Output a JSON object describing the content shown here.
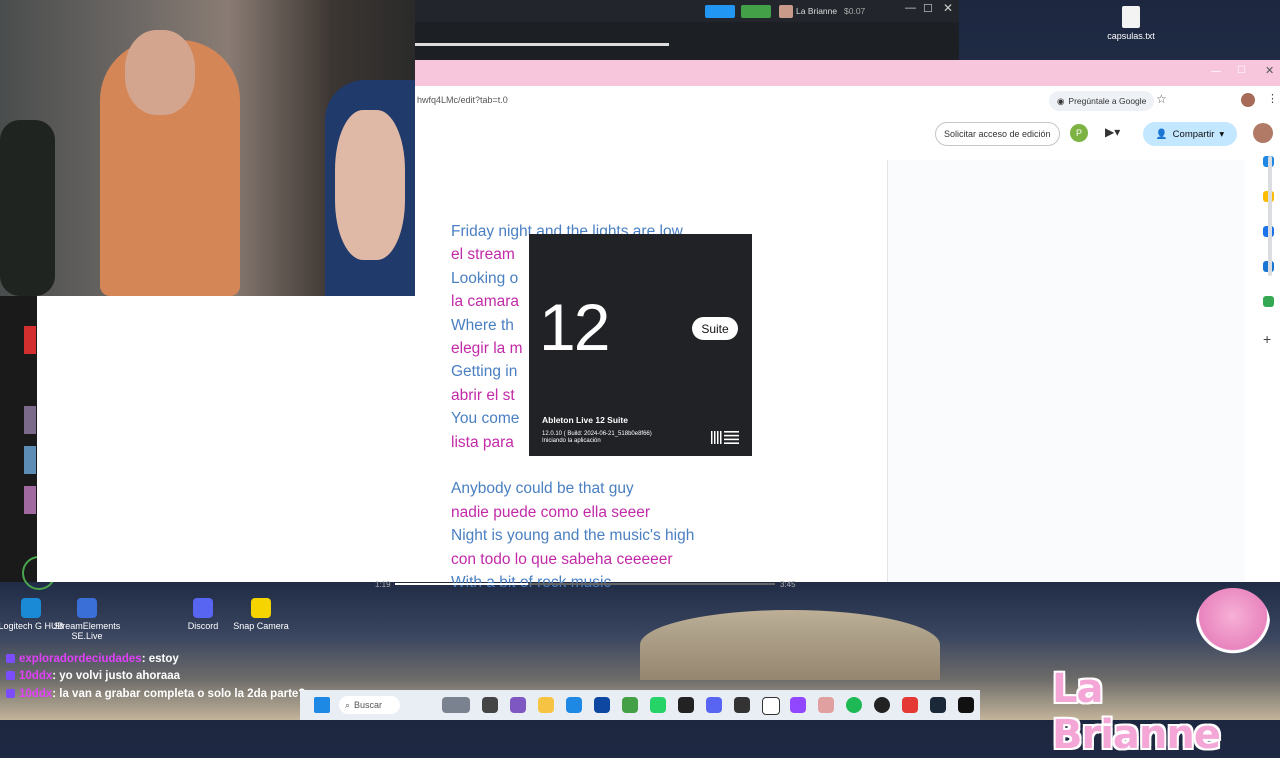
{
  "desktop": {
    "top_file": "capsulas.txt",
    "icons": [
      {
        "label": "Logitech G HUB"
      },
      {
        "label": "StreamElements SE.Live"
      },
      {
        "label": "Discord"
      },
      {
        "label": "Snap Camera"
      }
    ]
  },
  "top_app": {
    "user": "La Brianne",
    "balance": "$0.07"
  },
  "browser": {
    "url": "hwfq4LMc/edit?tab=t.0",
    "ask_google": "Pregúntale a Google"
  },
  "docs": {
    "request_edit": "Solicitar acceso de edición",
    "avatar_letter": "P",
    "share": "Compartir",
    "lyrics": [
      {
        "lang": "en",
        "text": "Friday night and the lights are low"
      },
      {
        "lang": "es",
        "text": "el stream"
      },
      {
        "lang": "en",
        "text": "Looking o"
      },
      {
        "lang": "es",
        "text": "la camara"
      },
      {
        "lang": "en",
        "text": "Where th"
      },
      {
        "lang": "es",
        "text": "elegir la m"
      },
      {
        "lang": "en",
        "text": "Getting in"
      },
      {
        "lang": "es",
        "text": "abrir el st"
      },
      {
        "lang": "en",
        "text": "You come"
      },
      {
        "lang": "es",
        "text": "lista para"
      },
      {
        "lang": "blank",
        "text": ""
      },
      {
        "lang": "en",
        "text": "Anybody could be that guy"
      },
      {
        "lang": "es",
        "text": "nadie puede como ella seeer"
      },
      {
        "lang": "en",
        "text": "Night is young and the music's high"
      },
      {
        "lang": "es",
        "text": "con todo lo que sabeha ceeeeer"
      },
      {
        "lang": "en",
        "text": "With a bit of rock music"
      }
    ]
  },
  "splash": {
    "version_big": "12",
    "edition_badge": "Suite",
    "product": "Ableton Live 12 Suite",
    "build": "12.0.10 ( Build: 2024-06-21_518b0e8f66)",
    "status": "Iniciando la aplicación"
  },
  "player": {
    "elapsed": "1:19",
    "total": "3:45"
  },
  "chat": [
    {
      "user": "exploradordeciudades",
      "msg": ": estoy"
    },
    {
      "user": "10ddx",
      "msg": ": yo volvi justo ahoraaa"
    },
    {
      "user": "10ddx",
      "msg": ": la van a grabar completa o solo la 2da parte?"
    }
  ],
  "overlay": {
    "brand": "La Brianne"
  },
  "taskbar": {
    "search_placeholder": "Buscar"
  },
  "colors": {
    "lyrics_en": "#4a7fc1",
    "lyrics_es": "#c22aa8",
    "chrome_tab_bar": "#f7c6dd",
    "share_button": "#c2e7ff",
    "splash_bg": "#202226"
  }
}
